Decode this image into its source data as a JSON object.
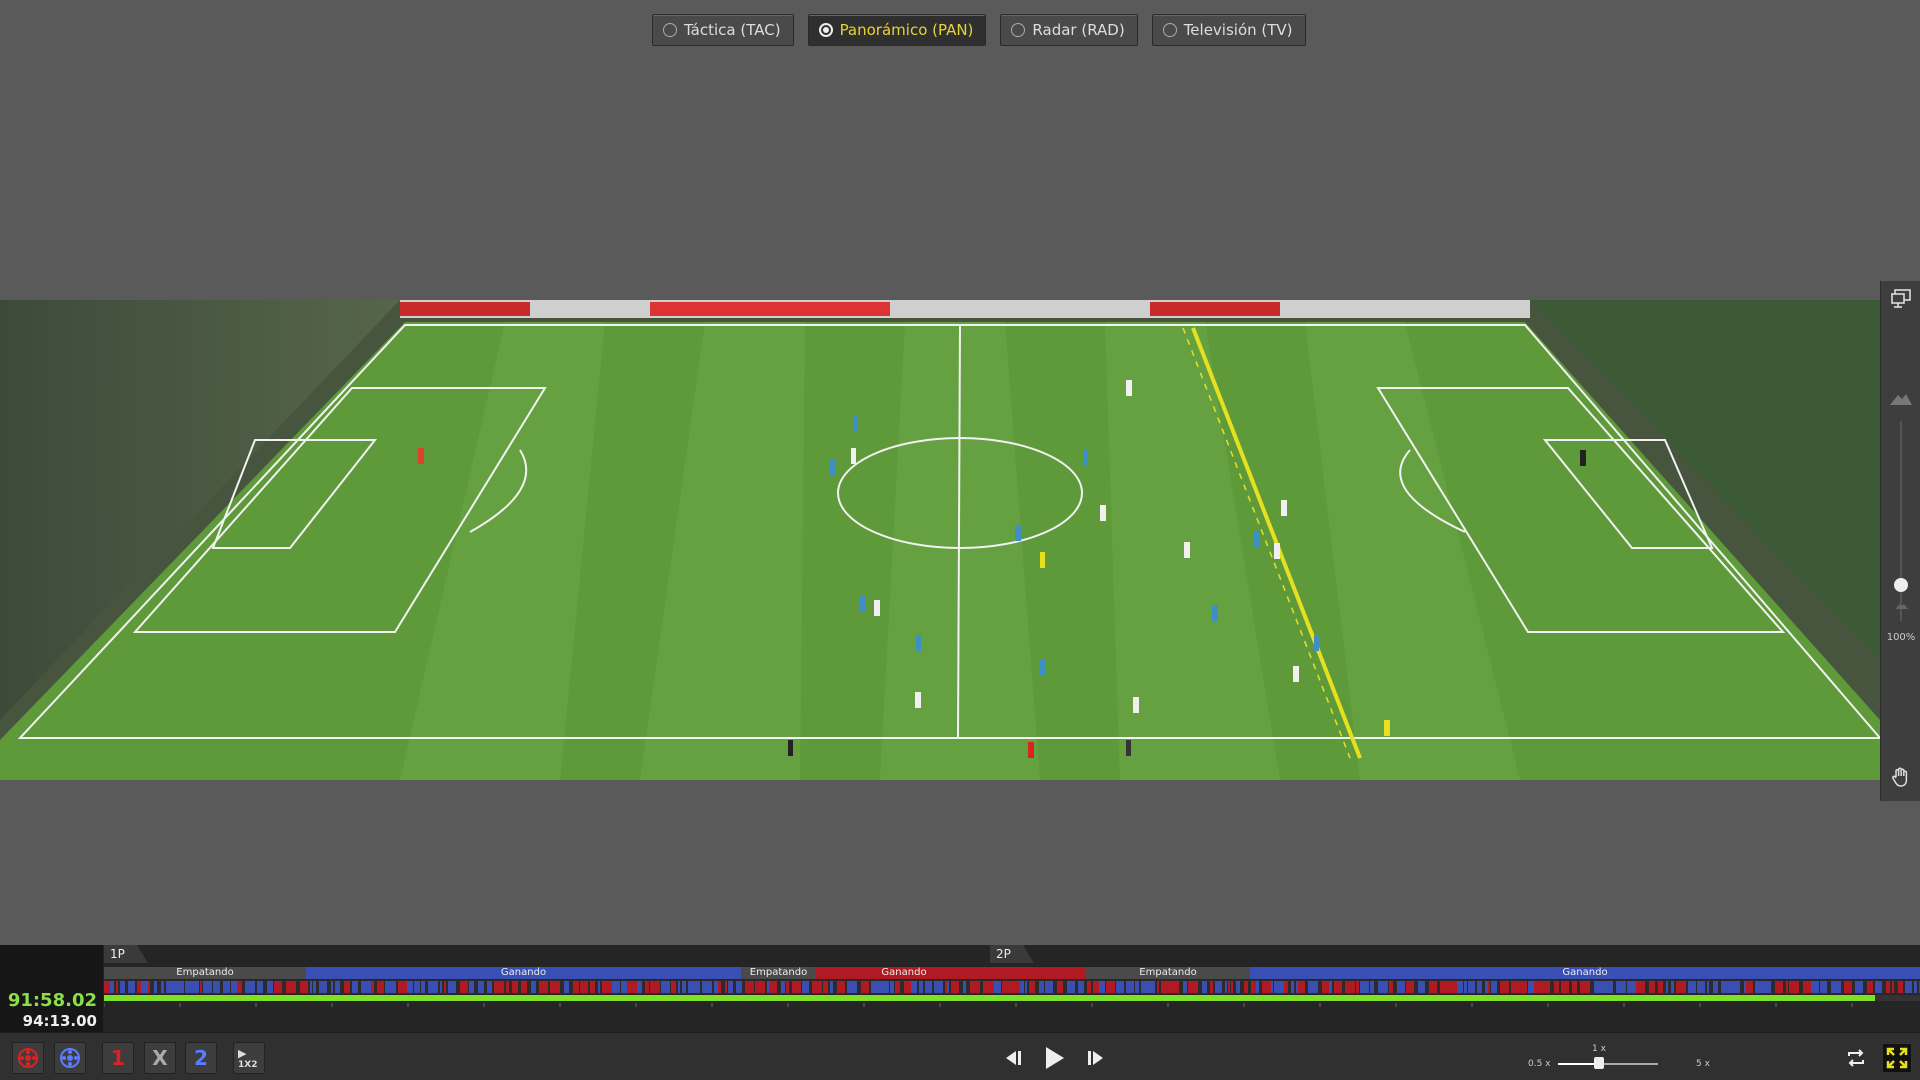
{
  "view_modes": [
    {
      "label": "Táctica (TAC)",
      "active": false
    },
    {
      "label": "Panorámico (PAN)",
      "active": true
    },
    {
      "label": "Radar (RAD)",
      "active": false
    },
    {
      "label": "Televisión (TV)",
      "active": false
    }
  ],
  "zoom": {
    "percent_label": "100%",
    "value": 1.0
  },
  "timeline": {
    "current_time": "91:58.02",
    "total_time": "94:13.00",
    "halves": [
      "1P",
      "2P"
    ],
    "states": [
      "Empatando",
      "Ganando",
      "Empatando",
      "Ganando",
      "Empatando",
      "Ganando"
    ],
    "progress": 0.975
  },
  "controls": {
    "team1_label": "1",
    "draw_label": "X",
    "team2_label": "2",
    "filter_label": "1X2",
    "speed_min": "0.5 x",
    "speed_current": "1 x",
    "speed_max": "5 x"
  },
  "colors": {
    "accent": "#e6d33a",
    "home": "#b11a22",
    "away": "#3a4fb4",
    "progress": "#7fe02a"
  }
}
